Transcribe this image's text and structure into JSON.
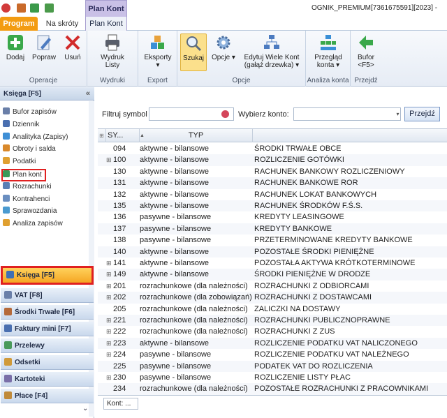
{
  "title_bar": {
    "context_header": "Plan Kont",
    "document_title": "OGNIK_PREMIUM[7361675591][2023] -"
  },
  "tabs": [
    {
      "label": "Program"
    },
    {
      "label": "Na skróty"
    },
    {
      "label": "Plan Kont"
    }
  ],
  "ribbon": {
    "groups": {
      "operacje": "Operacje",
      "wydruki": "Wydruki",
      "export": "Export",
      "opcje": "Opcje",
      "analiza": "Analiza konta",
      "przejdz": "Przejdź"
    },
    "buttons": {
      "dodaj": "Dodaj",
      "popraw": "Popraw",
      "usun": "Usuń",
      "wydruk_line1": "Wydruk",
      "wydruk_line2": "Listy",
      "eksporty": "Eksporty",
      "szukaj": "Szukaj",
      "opcje": "Opcje",
      "edytuj_line1": "Edytuj Wiele Kont",
      "edytuj_line2": "(gałąź drzewka)",
      "przeglad_line1": "Przegląd",
      "przeglad_line2": "konta",
      "bufor_line1": "Bufor",
      "bufor_line2": "<F5>"
    }
  },
  "left_pane": {
    "header": "Księga [F5]",
    "collapse": "«",
    "nav_items": [
      {
        "label": "Bufor zapisów",
        "color": "#6a7fa8"
      },
      {
        "label": "Dziennik",
        "color": "#4a6fb0"
      },
      {
        "label": "Analityka (Zapisy)",
        "color": "#3f8fd6"
      },
      {
        "label": "Obroty i salda",
        "color": "#d9892b"
      },
      {
        "label": "Podatki",
        "color": "#e0a030"
      },
      {
        "label": "Plan kont",
        "color": "#3a9a5a"
      },
      {
        "label": "Rozrachunki",
        "color": "#5a7fb5"
      },
      {
        "label": "Kontrahenci",
        "color": "#6a8ec0"
      },
      {
        "label": "Sprawozdania",
        "color": "#4a9ad0"
      },
      {
        "label": "Analiza zapisów",
        "color": "#e0a030"
      }
    ],
    "modules": [
      {
        "label": "Księga [F5]",
        "color": "#3f6fb5"
      },
      {
        "label": "VAT [F8]",
        "color": "#6a7fa8"
      },
      {
        "label": "Środki Trwałe [F6]",
        "color": "#b56a3a"
      },
      {
        "label": "Faktury mini [F7]",
        "color": "#4a6fb0"
      },
      {
        "label": "Przelewy",
        "color": "#4a9a5a"
      },
      {
        "label": "Odsetki",
        "color": "#d09a3a"
      },
      {
        "label": "Kartoteki",
        "color": "#7a6fa8"
      },
      {
        "label": "Płace [F4]",
        "color": "#c08a3a"
      }
    ],
    "bottom_arrow": "⌄"
  },
  "filter": {
    "filtruj_label": "Filtruj symbol",
    "wybierz_label": "Wybierz konto:",
    "przejdz_button": "Przejdź"
  },
  "grid": {
    "columns": {
      "symbol": "SY...",
      "typ": "TYP",
      "nazwa": ""
    },
    "rows": [
      {
        "expand": "",
        "symbol": "094",
        "typ": "aktywne - bilansowe",
        "nazwa": "ŚRODKI TRWAŁE OBCE"
      },
      {
        "expand": "⊞",
        "symbol": "100",
        "typ": "aktywne - bilansowe",
        "nazwa": "ROZLICZENIE GOTÓWKI"
      },
      {
        "expand": "",
        "symbol": "130",
        "typ": "aktywne - bilansowe",
        "nazwa": "RACHUNEK BANKOWY ROZLICZENIOWY"
      },
      {
        "expand": "",
        "symbol": "131",
        "typ": "aktywne - bilansowe",
        "nazwa": "RACHUNEK BANKOWE ROR"
      },
      {
        "expand": "",
        "symbol": "132",
        "typ": "aktywne - bilansowe",
        "nazwa": "RACHUNEK LOKAT BANKOWYCH"
      },
      {
        "expand": "",
        "symbol": "135",
        "typ": "aktywne - bilansowe",
        "nazwa": "RACHUNEK ŚRODKÓW F.Ś.S."
      },
      {
        "expand": "",
        "symbol": "136",
        "typ": "pasywne - bilansowe",
        "nazwa": "KREDYTY LEASINGOWE"
      },
      {
        "expand": "",
        "symbol": "137",
        "typ": "pasywne - bilansowe",
        "nazwa": "KREDYTY BANKOWE"
      },
      {
        "expand": "",
        "symbol": "138",
        "typ": "pasywne - bilansowe",
        "nazwa": "PRZETERMINOWANE KREDYTY BANKOWE"
      },
      {
        "expand": "",
        "symbol": "140",
        "typ": "aktywne - bilansowe",
        "nazwa": "POZOSTAŁE ŚRODKI PIENIĘŻNE"
      },
      {
        "expand": "⊞",
        "symbol": "141",
        "typ": "aktywne - bilansowe",
        "nazwa": "POZOSTAŁA AKTYWA KRÓTKOTERMINOWE"
      },
      {
        "expand": "⊞",
        "symbol": "149",
        "typ": "aktywne - bilansowe",
        "nazwa": "ŚRODKI PIENIĘŻNE W DRODZE"
      },
      {
        "expand": "⊞",
        "symbol": "201",
        "typ": "rozrachunkowe (dla należności)",
        "nazwa": "ROZRACHUNKI Z ODBIORCAMI"
      },
      {
        "expand": "⊞",
        "symbol": "202",
        "typ": "rozrachunkowe (dla zobowiązań)",
        "nazwa": "ROZRACHUNKI Z DOSTAWCAMI"
      },
      {
        "expand": "",
        "symbol": "205",
        "typ": "rozrachunkowe (dla należności)",
        "nazwa": "ZALICZKI NA DOSTAWY"
      },
      {
        "expand": "⊞",
        "symbol": "221",
        "typ": "rozrachunkowe (dla należności)",
        "nazwa": "ROZRACHUNKI PUBLICZNOPRAWNE"
      },
      {
        "expand": "⊞",
        "symbol": "222",
        "typ": "rozrachunkowe (dla należności)",
        "nazwa": "ROZRACHUNKI Z ZUS"
      },
      {
        "expand": "⊞",
        "symbol": "223",
        "typ": "aktywne - bilansowe",
        "nazwa": "ROZLICZENIE PODATKU VAT NALICZONEGO"
      },
      {
        "expand": "⊞",
        "symbol": "224",
        "typ": "pasywne - bilansowe",
        "nazwa": "ROZLICZENIE PODATKU VAT NALEŻNEGO"
      },
      {
        "expand": "",
        "symbol": "225",
        "typ": "pasywne - bilansowe",
        "nazwa": "PODATEK VAT DO ROZLICZENIA"
      },
      {
        "expand": "⊞",
        "symbol": "230",
        "typ": "pasywne - bilansowe",
        "nazwa": "ROZLICZENIE LISTY PŁAC"
      },
      {
        "expand": "",
        "symbol": "234",
        "typ": "rozrachunkowe (dla należności)",
        "nazwa": "POZOSTAŁE ROZRACHUNKI Z PRACOWNIKAMI"
      }
    ]
  },
  "footer": {
    "konto_label": "Kont: ..."
  }
}
